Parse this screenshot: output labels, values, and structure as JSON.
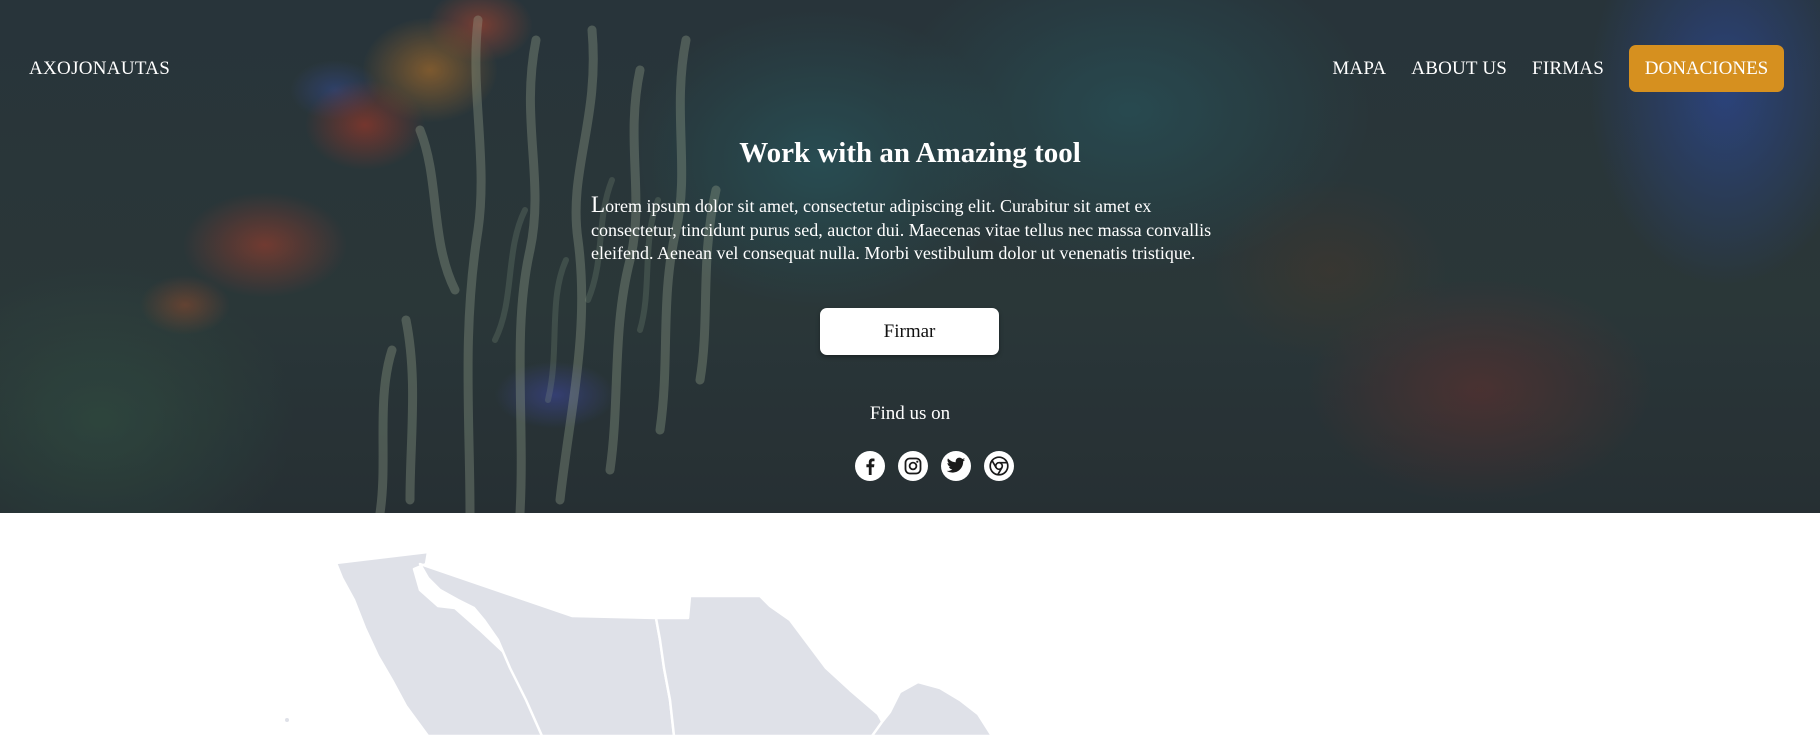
{
  "header": {
    "brand": "AXOJONAUTAS",
    "nav": [
      "MAPA",
      "ABOUT US",
      "FIRMAS"
    ],
    "donate_label": "DONACIONES"
  },
  "hero": {
    "title": "Work with an Amazing tool",
    "body_first_letter": "L",
    "body_rest": "orem ipsum dolor sit amet, consectetur adipiscing elit. Curabitur sit amet ex consectetur, tincidunt purus sed, auctor dui. Maecenas vitae tellus nec massa convallis eleifend. Aenean vel consequat nulla. Morbi vestibulum dolor ut venenatis tristique.",
    "cta_label": "Firmar",
    "find_us_label": "Find us on"
  },
  "socials": [
    {
      "icon": "facebook-icon"
    },
    {
      "icon": "instagram-icon"
    },
    {
      "icon": "twitter-icon"
    },
    {
      "icon": "chrome-icon"
    }
  ],
  "colors": {
    "accent": "#d6901f",
    "map_fill": "#dfe1e8",
    "text_on_hero": "#ffffff"
  }
}
